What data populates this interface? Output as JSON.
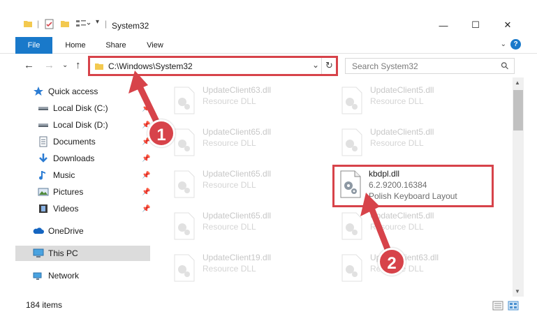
{
  "window": {
    "title": "System32",
    "minimize_glyph": "—",
    "maximize_glyph": "☐",
    "close_glyph": "✕"
  },
  "ribbon": {
    "tabs": [
      "File",
      "Home",
      "Share",
      "View"
    ],
    "help_glyph": "?",
    "collapse_glyph": "⌄"
  },
  "address": {
    "path": "C:\\Windows\\System32",
    "dropdown_glyph": "⌄",
    "refresh_glyph": "↻"
  },
  "search": {
    "placeholder": "Search System32",
    "icon_glyph": "⚲"
  },
  "nav_glyphs": {
    "back": "←",
    "forward": "→",
    "recent": "⌄",
    "up": "↑"
  },
  "sidebar": {
    "items": [
      {
        "label": "Quick access",
        "icon": "star-icon",
        "pinned": false
      },
      {
        "label": "Local Disk (C:)",
        "icon": "drive-icon",
        "pinned": true
      },
      {
        "label": "Local Disk (D:)",
        "icon": "drive-icon",
        "pinned": true
      },
      {
        "label": "Documents",
        "icon": "documents-icon",
        "pinned": true
      },
      {
        "label": "Downloads",
        "icon": "downloads-icon",
        "pinned": true
      },
      {
        "label": "Music",
        "icon": "music-icon",
        "pinned": true
      },
      {
        "label": "Pictures",
        "icon": "pictures-icon",
        "pinned": true
      },
      {
        "label": "Videos",
        "icon": "videos-icon",
        "pinned": true
      },
      {
        "label": "OneDrive",
        "icon": "cloud-icon",
        "pinned": false
      },
      {
        "label": "This PC",
        "icon": "computer-icon",
        "pinned": false,
        "selected": true
      },
      {
        "label": "Network",
        "icon": "network-icon",
        "pinned": false
      }
    ],
    "pin_glyph": "📌"
  },
  "files": [
    {
      "name": "UpdateClient63.dll",
      "type": "Resource DLL"
    },
    {
      "name": "UpdateClient5.dll",
      "type": "Resource DLL"
    },
    {
      "name": "UpdateClient65.dll",
      "type": "Resource DLL"
    },
    {
      "name": "UpdateClient5.dll",
      "type": "Resource DLL"
    },
    {
      "name": "UpdateClient65.dll",
      "type": "Resource DLL"
    },
    {
      "name": "kbdpl.dll",
      "version": "6.2.9200.16384",
      "type": "Polish Keyboard Layout",
      "active": true
    },
    {
      "name": "UpdateClient65.dll",
      "type": "Resource DLL"
    },
    {
      "name": "UpdateClient5.dll",
      "type": "Resource DLL"
    },
    {
      "name": "UpdateClient19.dll",
      "type": "Resource DLL"
    },
    {
      "name": "UpdateClient63.dll",
      "type": "Resource DLL"
    }
  ],
  "status": {
    "item_count": "184 items"
  },
  "callouts": [
    "1",
    "2"
  ],
  "colors": {
    "accent": "#1979ca",
    "highlight": "#d7434a"
  }
}
